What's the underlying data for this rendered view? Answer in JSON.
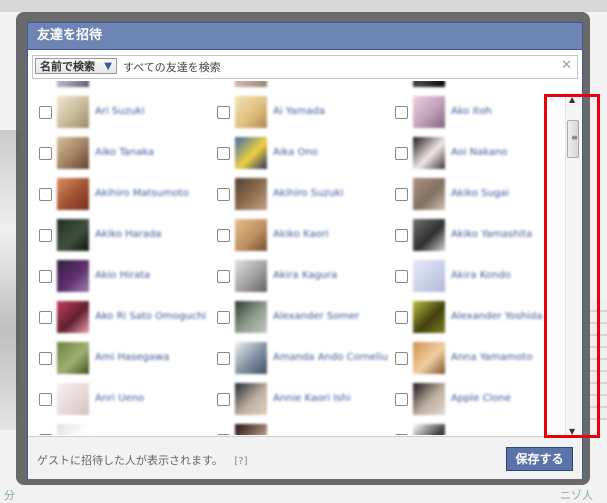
{
  "dialog": {
    "title": "友達を招待",
    "filter_label": "名前で検索",
    "search_placeholder": "すべての友達を検索",
    "footer_note": "ゲストに招待した人が表示されます。",
    "help_label": "[?]",
    "save_label": "保存する"
  },
  "background": {
    "bottom_left_text": "分",
    "bottom_right_text": "ニゾ人"
  },
  "friends": [
    {
      "name": "",
      "colors": [
        "#ddd",
        "#aab",
        "#556"
      ]
    },
    {
      "name": "",
      "colors": [
        "#e8d8b0",
        "#caa",
        "#886"
      ]
    },
    {
      "name": "",
      "colors": [
        "#111",
        "#444",
        "#000"
      ]
    },
    {
      "name": "Ari Suzuki",
      "colors": [
        "#f0e8d0",
        "#c9b89a",
        "#9c8a6a"
      ]
    },
    {
      "name": "Ai Yamada",
      "colors": [
        "#f3e3b0",
        "#e0c080",
        "#b08850"
      ]
    },
    {
      "name": "Ako Itoh",
      "colors": [
        "#f0d0e0",
        "#c0a0b8",
        "#806080"
      ]
    },
    {
      "name": "Aiko Tanaka",
      "colors": [
        "#d8c0a0",
        "#a08060",
        "#604030"
      ]
    },
    {
      "name": "Aika Ono",
      "colors": [
        "#3a6ab0",
        "#f0d040",
        "#203060"
      ]
    },
    {
      "name": "Aoi Nakano",
      "colors": [
        "#201818",
        "#f0e8e8",
        "#403030"
      ]
    },
    {
      "name": "Akihiro Matsumoto",
      "colors": [
        "#d89060",
        "#a05030",
        "#703020"
      ]
    },
    {
      "name": "Akihiro Suzuki",
      "colors": [
        "#504030",
        "#907050",
        "#c0a080"
      ]
    },
    {
      "name": "Akiko Sugai",
      "colors": [
        "#b09080",
        "#807060",
        "#d0c0b0"
      ]
    },
    {
      "name": "Akiko Harada",
      "colors": [
        "#203020",
        "#405040",
        "#101810"
      ]
    },
    {
      "name": "Akiko Kaori",
      "colors": [
        "#e0c090",
        "#c09060",
        "#705030"
      ]
    },
    {
      "name": "Akiko Yamashita",
      "colors": [
        "#707070",
        "#303030",
        "#d0d0d0"
      ]
    },
    {
      "name": "Akio Hirata",
      "colors": [
        "#302040",
        "#603070",
        "#a080b0"
      ]
    },
    {
      "name": "Akira Kagura",
      "colors": [
        "#e0e0e0",
        "#a0a0a0",
        "#606060"
      ]
    },
    {
      "name": "Akira Kondo",
      "colors": [
        "#e8e8f8",
        "#c8d0e8",
        "#b0b8d8"
      ]
    },
    {
      "name": "Ako Ri Sato Omoguchi",
      "colors": [
        "#c04060",
        "#602030",
        "#f0a0b0"
      ]
    },
    {
      "name": "Alexander Somer",
      "colors": [
        "#303830",
        "#90a090",
        "#c0c8c0"
      ]
    },
    {
      "name": "Alexander Yoshida",
      "colors": [
        "#c0c040",
        "#404010",
        "#808020"
      ]
    },
    {
      "name": "Ami Hasegawa",
      "colors": [
        "#6a8040",
        "#a0b070",
        "#405020"
      ]
    },
    {
      "name": "Amanda Ando Cornelius",
      "colors": [
        "#f0f0f0",
        "#8090a0",
        "#405060"
      ]
    },
    {
      "name": "Anna Yamamoto",
      "colors": [
        "#d09050",
        "#f0d0a0",
        "#805030"
      ]
    },
    {
      "name": "Anri Ueno",
      "colors": [
        "#f8f0f0",
        "#e8d8d8",
        "#d0c0c0"
      ]
    },
    {
      "name": "Annie Kaori Ishi",
      "colors": [
        "#202838",
        "#c0b0a0",
        "#e0d0c0"
      ]
    },
    {
      "name": "Apple Clone",
      "colors": [
        "#201818",
        "#c0b0a0",
        "#e0d8d0"
      ]
    },
    {
      "name": "",
      "colors": [
        "#e0e0e0",
        "#fff",
        "#ddd"
      ]
    },
    {
      "name": "",
      "colors": [
        "#201010",
        "#a08070",
        "#fff"
      ]
    },
    {
      "name": "",
      "colors": [
        "#fff",
        "#444",
        "#222"
      ]
    }
  ]
}
